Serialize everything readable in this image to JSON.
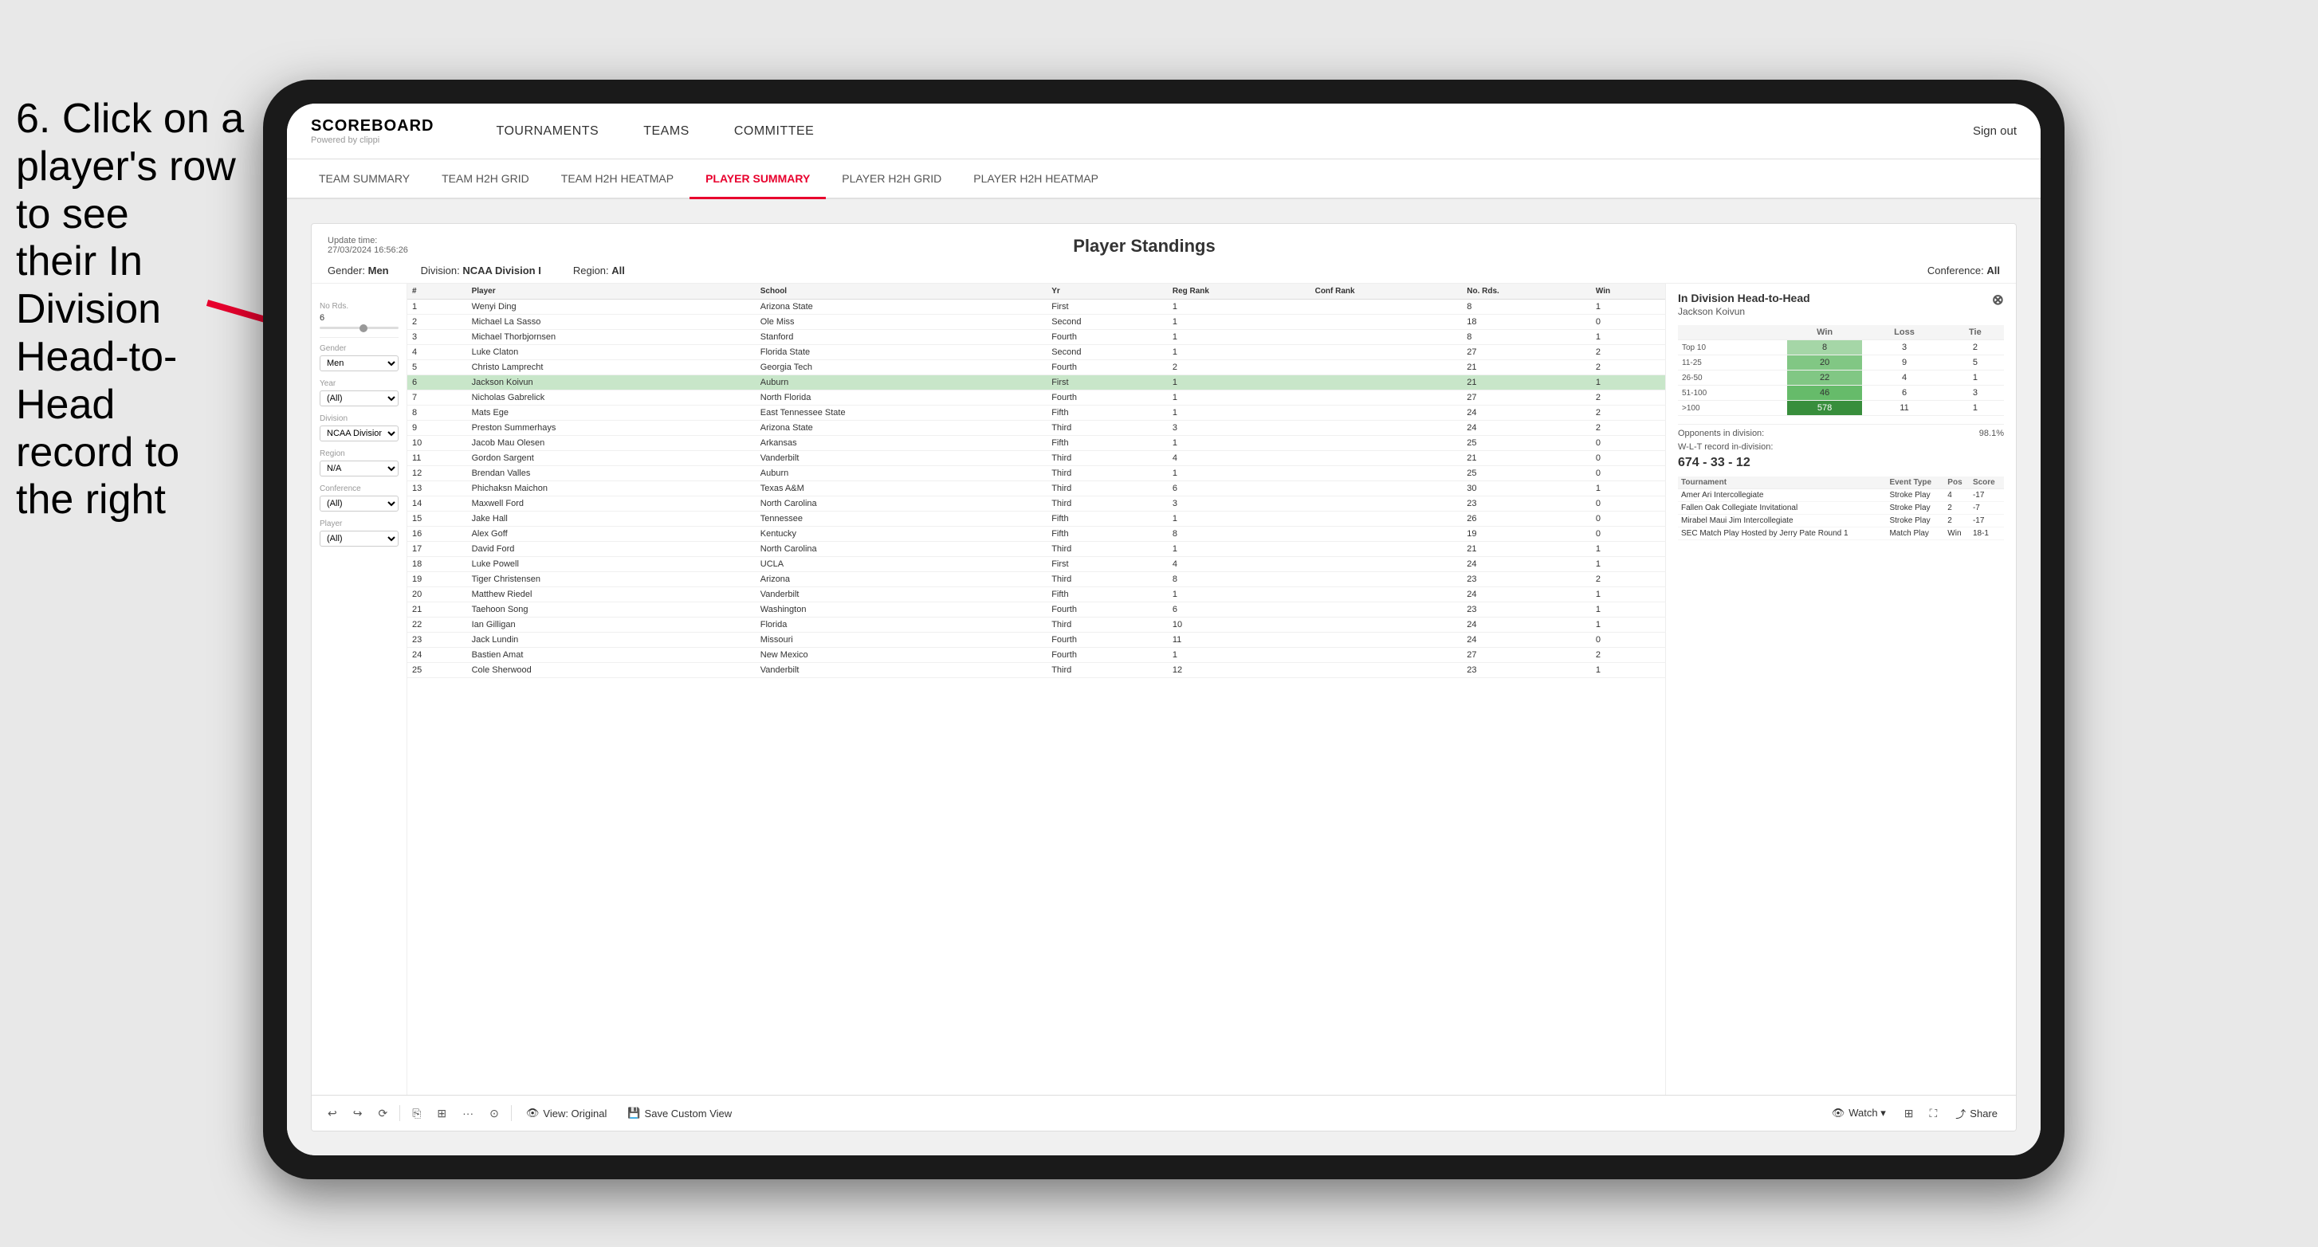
{
  "instruction": {
    "line1": "6. Click on a",
    "line2": "player's row to see",
    "line3": "their In Division",
    "line4": "Head-to-Head",
    "line5": "record to the right"
  },
  "nav": {
    "logo": "SCOREBOARD",
    "logo_sub": "Powered by clippi",
    "items": [
      "TOURNAMENTS",
      "TEAMS",
      "COMMITTEE"
    ],
    "sign_out": "Sign out"
  },
  "sub_nav": {
    "items": [
      "TEAM SUMMARY",
      "TEAM H2H GRID",
      "TEAM H2H HEATMAP",
      "PLAYER SUMMARY",
      "PLAYER H2H GRID",
      "PLAYER H2H HEATMAP"
    ],
    "active": "PLAYER SUMMARY"
  },
  "dashboard": {
    "update_label": "Update time:",
    "update_time": "27/03/2024 16:56:26",
    "title": "Player Standings",
    "filters": {
      "gender_label": "Gender:",
      "gender_value": "Men",
      "division_label": "Division:",
      "division_value": "NCAA Division I",
      "region_label": "Region:",
      "region_value": "All",
      "conference_label": "Conference:",
      "conference_value": "All"
    }
  },
  "left_panel": {
    "no_rds_label": "No Rds.",
    "no_rds_range": "6",
    "gender_label": "Gender",
    "gender_value": "Men",
    "year_label": "Year",
    "year_value": "(All)",
    "division_label": "Division",
    "division_value": "NCAA Division I",
    "region_label": "Region",
    "region_value": "N/A",
    "conference_label": "Conference",
    "conference_value": "(All)",
    "player_label": "Player",
    "player_value": "(All)"
  },
  "table": {
    "headers": [
      "#",
      "Player",
      "School",
      "Yr",
      "Reg Rank",
      "Conf Rank",
      "No. Rds.",
      "Win"
    ],
    "rows": [
      {
        "num": "1",
        "player": "Wenyi Ding",
        "school": "Arizona State",
        "yr": "First",
        "reg_rank": "1",
        "conf_rank": "",
        "rds": "8",
        "win": "1"
      },
      {
        "num": "2",
        "player": "Michael La Sasso",
        "school": "Ole Miss",
        "yr": "Second",
        "reg_rank": "1",
        "conf_rank": "",
        "rds": "18",
        "win": "0"
      },
      {
        "num": "3",
        "player": "Michael Thorbjornsen",
        "school": "Stanford",
        "yr": "Fourth",
        "reg_rank": "1",
        "conf_rank": "",
        "rds": "8",
        "win": "1"
      },
      {
        "num": "4",
        "player": "Luke Claton",
        "school": "Florida State",
        "yr": "Second",
        "reg_rank": "1",
        "conf_rank": "",
        "rds": "27",
        "win": "2"
      },
      {
        "num": "5",
        "player": "Christo Lamprecht",
        "school": "Georgia Tech",
        "yr": "Fourth",
        "reg_rank": "2",
        "conf_rank": "",
        "rds": "21",
        "win": "2"
      },
      {
        "num": "6",
        "player": "Jackson Koivun",
        "school": "Auburn",
        "yr": "First",
        "reg_rank": "1",
        "conf_rank": "",
        "rds": "21",
        "win": "1",
        "selected": true
      },
      {
        "num": "7",
        "player": "Nicholas Gabrelick",
        "school": "North Florida",
        "yr": "Fourth",
        "reg_rank": "1",
        "conf_rank": "",
        "rds": "27",
        "win": "2"
      },
      {
        "num": "8",
        "player": "Mats Ege",
        "school": "East Tennessee State",
        "yr": "Fifth",
        "reg_rank": "1",
        "conf_rank": "",
        "rds": "24",
        "win": "2"
      },
      {
        "num": "9",
        "player": "Preston Summerhays",
        "school": "Arizona State",
        "yr": "Third",
        "reg_rank": "3",
        "conf_rank": "",
        "rds": "24",
        "win": "2"
      },
      {
        "num": "10",
        "player": "Jacob Mau Olesen",
        "school": "Arkansas",
        "yr": "Fifth",
        "reg_rank": "1",
        "conf_rank": "",
        "rds": "25",
        "win": "0"
      },
      {
        "num": "11",
        "player": "Gordon Sargent",
        "school": "Vanderbilt",
        "yr": "Third",
        "reg_rank": "4",
        "conf_rank": "",
        "rds": "21",
        "win": "0"
      },
      {
        "num": "12",
        "player": "Brendan Valles",
        "school": "Auburn",
        "yr": "Third",
        "reg_rank": "1",
        "conf_rank": "",
        "rds": "25",
        "win": "0"
      },
      {
        "num": "13",
        "player": "Phichaksn Maichon",
        "school": "Texas A&M",
        "yr": "Third",
        "reg_rank": "6",
        "conf_rank": "",
        "rds": "30",
        "win": "1"
      },
      {
        "num": "14",
        "player": "Maxwell Ford",
        "school": "North Carolina",
        "yr": "Third",
        "reg_rank": "3",
        "conf_rank": "",
        "rds": "23",
        "win": "0"
      },
      {
        "num": "15",
        "player": "Jake Hall",
        "school": "Tennessee",
        "yr": "Fifth",
        "reg_rank": "1",
        "conf_rank": "",
        "rds": "26",
        "win": "0"
      },
      {
        "num": "16",
        "player": "Alex Goff",
        "school": "Kentucky",
        "yr": "Fifth",
        "reg_rank": "8",
        "conf_rank": "",
        "rds": "19",
        "win": "0"
      },
      {
        "num": "17",
        "player": "David Ford",
        "school": "North Carolina",
        "yr": "Third",
        "reg_rank": "1",
        "conf_rank": "",
        "rds": "21",
        "win": "1"
      },
      {
        "num": "18",
        "player": "Luke Powell",
        "school": "UCLA",
        "yr": "First",
        "reg_rank": "4",
        "conf_rank": "",
        "rds": "24",
        "win": "1"
      },
      {
        "num": "19",
        "player": "Tiger Christensen",
        "school": "Arizona",
        "yr": "Third",
        "reg_rank": "8",
        "conf_rank": "",
        "rds": "23",
        "win": "2"
      },
      {
        "num": "20",
        "player": "Matthew Riedel",
        "school": "Vanderbilt",
        "yr": "Fifth",
        "reg_rank": "1",
        "conf_rank": "",
        "rds": "24",
        "win": "1"
      },
      {
        "num": "21",
        "player": "Taehoon Song",
        "school": "Washington",
        "yr": "Fourth",
        "reg_rank": "6",
        "conf_rank": "",
        "rds": "23",
        "win": "1"
      },
      {
        "num": "22",
        "player": "Ian Gilligan",
        "school": "Florida",
        "yr": "Third",
        "reg_rank": "10",
        "conf_rank": "",
        "rds": "24",
        "win": "1"
      },
      {
        "num": "23",
        "player": "Jack Lundin",
        "school": "Missouri",
        "yr": "Fourth",
        "reg_rank": "11",
        "conf_rank": "",
        "rds": "24",
        "win": "0"
      },
      {
        "num": "24",
        "player": "Bastien Amat",
        "school": "New Mexico",
        "yr": "Fourth",
        "reg_rank": "1",
        "conf_rank": "",
        "rds": "27",
        "win": "2"
      },
      {
        "num": "25",
        "player": "Cole Sherwood",
        "school": "Vanderbilt",
        "yr": "Third",
        "reg_rank": "12",
        "conf_rank": "",
        "rds": "23",
        "win": "1"
      }
    ]
  },
  "h2h": {
    "title": "In Division Head-to-Head",
    "player_name": "Jackson Koivun",
    "rank_groups": [
      "Top 10",
      "11-25",
      "26-50",
      "51-100",
      ">100"
    ],
    "columns": [
      "Win",
      "Loss",
      "Tie"
    ],
    "data": [
      {
        "group": "Top 10",
        "win": "8",
        "loss": "3",
        "tie": "2",
        "win_color": "light"
      },
      {
        "group": "11-25",
        "win": "20",
        "loss": "9",
        "tie": "5",
        "win_color": "mid"
      },
      {
        "group": "26-50",
        "win": "22",
        "loss": "4",
        "tie": "1",
        "win_color": "mid"
      },
      {
        "group": "51-100",
        "win": "46",
        "loss": "6",
        "tie": "3",
        "win_color": "dark"
      },
      {
        "group": ">100",
        "win": "578",
        "loss": "11",
        "tie": "1",
        "win_color": "deepest"
      }
    ],
    "opponents_label": "Opponents in division:",
    "opponents_percent": "98.1%",
    "wl_label": "W-L-T record in-division:",
    "wl_record": "674 - 33 - 12",
    "tournament_headers": [
      "Tournament",
      "Event Type",
      "Pos",
      "Score"
    ],
    "tournaments": [
      {
        "name": "Amer Ari Intercollegiate",
        "type": "Stroke Play",
        "pos": "4",
        "score": "-17"
      },
      {
        "name": "Fallen Oak Collegiate Invitational",
        "type": "Stroke Play",
        "pos": "2",
        "score": "-7"
      },
      {
        "name": "Mirabel Maui Jim Intercollegiate",
        "type": "Stroke Play",
        "pos": "2",
        "score": "-17"
      },
      {
        "name": "SEC Match Play Hosted by Jerry Pate Round 1",
        "type": "Match Play",
        "pos": "Win",
        "score": "18-1"
      }
    ]
  },
  "toolbar": {
    "undo": "↩",
    "redo": "↪",
    "reset": "⟳",
    "copy": "⎘",
    "paste": "⎗",
    "more": "...",
    "restore": "⊙",
    "view_original": "View: Original",
    "save_custom": "Save Custom View",
    "watch": "Watch ▾",
    "share": "Share"
  }
}
